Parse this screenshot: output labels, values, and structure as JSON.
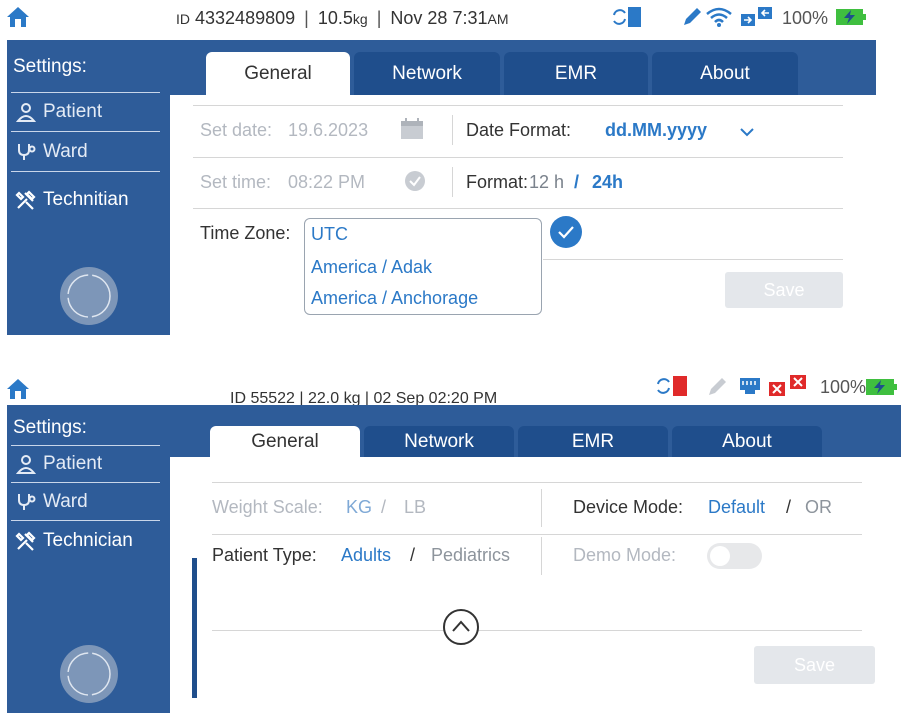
{
  "panel1": {
    "status": {
      "id_label": "ID",
      "id_value": "4332489809",
      "weight_value": "10.5",
      "weight_unit": "kg",
      "datetime": "Nov 28  7:31",
      "ampm": "AM",
      "battery": "100%"
    },
    "sidebar": {
      "title": "Settings:",
      "items": [
        {
          "label": "Patient",
          "icon": "person-icon"
        },
        {
          "label": "Ward",
          "icon": "stethoscope-icon"
        },
        {
          "label": "Technitian",
          "icon": "tools-icon"
        }
      ]
    },
    "tabs": [
      "General",
      "Network",
      "EMR",
      "About"
    ],
    "settings": {
      "set_date_label": "Set date:",
      "set_date_value": "19.6.2023",
      "date_format_label": "Date Format:",
      "date_format_value": "dd.MM.yyyy",
      "set_time_label": "Set time:",
      "set_time_value": "08:22 PM",
      "format_label": "Format:",
      "format_12": "12 h",
      "format_sep": "/",
      "format_24": "24h",
      "timezone_label": "Time Zone:",
      "timezone_options": [
        "UTC",
        "America / Adak",
        "America / Anchorage"
      ]
    },
    "save_label": "Save"
  },
  "panel2": {
    "status": {
      "text": "ID 55522 | 22.0 kg | 02 Sep  02:20 PM",
      "battery": "100%"
    },
    "sidebar": {
      "title": "Settings:",
      "items": [
        {
          "label": "Patient",
          "icon": "person-icon"
        },
        {
          "label": "Ward",
          "icon": "stethoscope-icon"
        },
        {
          "label": "Technician",
          "icon": "tools-icon"
        }
      ]
    },
    "tabs": [
      "General",
      "Network",
      "EMR",
      "About"
    ],
    "settings": {
      "weight_scale_label": "Weight Scale:",
      "weight_kg": "KG",
      "weight_sep": "/",
      "weight_lb": "LB",
      "device_mode_label": "Device Mode:",
      "device_mode_default": "Default",
      "device_mode_sep": "/",
      "device_mode_or": "OR",
      "patient_type_label": "Patient Type:",
      "patient_type_adults": "Adults",
      "patient_type_sep": "/",
      "patient_type_pediatrics": "Pediatrics",
      "demo_mode_label": "Demo Mode:",
      "demo_mode_on": false
    },
    "save_label": "Save"
  },
  "colors": {
    "sidebar_blue": "#2e5c99",
    "tab_blue": "#1f4e8c",
    "accent_blue": "#2b79c7",
    "battery_green": "#3fbf3f",
    "alert_red": "#e02a2a"
  }
}
